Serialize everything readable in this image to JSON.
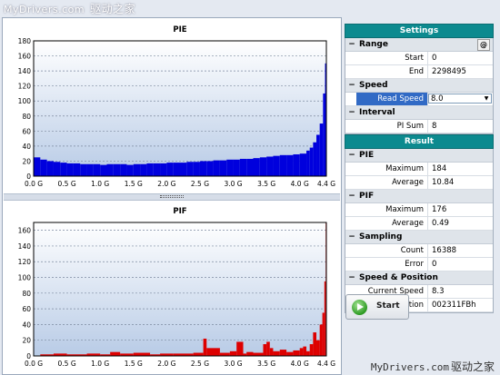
{
  "watermark_top": {
    "text": "MyDrivers.com",
    "zh": "驱动之家"
  },
  "watermark_bottom": {
    "text": "MyDrivers.com",
    "zh": "驱动之家"
  },
  "chart_data": [
    {
      "type": "bar",
      "title": "PIE",
      "color": "#0000dd",
      "xlim": [
        0,
        4.4
      ],
      "ylim": [
        0,
        180
      ],
      "xticks": [
        "0.0 G",
        "0.5 G",
        "1.0 G",
        "1.5 G",
        "2.0 G",
        "2.5 G",
        "3.0 G",
        "3.5 G",
        "4.0 G",
        "4.4 G"
      ],
      "xtick_values": [
        0,
        0.5,
        1.0,
        1.5,
        2.0,
        2.5,
        3.0,
        3.5,
        4.0,
        4.4
      ],
      "yticks": [
        0,
        20,
        40,
        60,
        80,
        100,
        120,
        140,
        160,
        180
      ],
      "x": [
        0.0,
        0.1,
        0.2,
        0.3,
        0.4,
        0.5,
        0.6,
        0.7,
        0.8,
        0.9,
        1.0,
        1.1,
        1.2,
        1.3,
        1.4,
        1.5,
        1.6,
        1.7,
        1.8,
        1.9,
        2.0,
        2.1,
        2.2,
        2.3,
        2.4,
        2.5,
        2.6,
        2.7,
        2.8,
        2.9,
        3.0,
        3.1,
        3.2,
        3.3,
        3.4,
        3.5,
        3.6,
        3.7,
        3.8,
        3.9,
        4.0,
        4.1,
        4.15,
        4.2,
        4.25,
        4.3,
        4.35,
        4.38
      ],
      "values": [
        25,
        22,
        20,
        19,
        18,
        17,
        17,
        16,
        16,
        16,
        15,
        16,
        16,
        16,
        15,
        16,
        16,
        17,
        17,
        17,
        18,
        18,
        18,
        19,
        19,
        20,
        20,
        21,
        21,
        22,
        22,
        23,
        23,
        24,
        25,
        26,
        27,
        28,
        28,
        29,
        30,
        34,
        38,
        45,
        55,
        70,
        110,
        150
      ]
    },
    {
      "type": "bar",
      "title": "PIF",
      "color": "#dd0000",
      "xlim": [
        0,
        4.4
      ],
      "ylim": [
        0,
        170
      ],
      "xticks": [
        "0.0 G",
        "0.5 G",
        "1.0 G",
        "1.5 G",
        "2.0 G",
        "2.5 G",
        "3.0 G",
        "3.5 G",
        "4.0 G",
        "4.4 G"
      ],
      "xtick_values": [
        0,
        0.5,
        1.0,
        1.5,
        2.0,
        2.5,
        3.0,
        3.5,
        4.0,
        4.4
      ],
      "yticks": [
        0,
        20,
        40,
        60,
        80,
        100,
        120,
        140,
        160
      ],
      "x": [
        0.1,
        0.3,
        0.5,
        0.8,
        1.0,
        1.15,
        1.3,
        1.5,
        1.75,
        1.9,
        2.1,
        2.2,
        2.4,
        2.55,
        2.6,
        2.8,
        2.95,
        3.05,
        3.15,
        3.2,
        3.3,
        3.45,
        3.5,
        3.55,
        3.6,
        3.7,
        3.8,
        3.9,
        4.0,
        4.05,
        4.1,
        4.15,
        4.2,
        4.25,
        4.3,
        4.34,
        4.37,
        4.39
      ],
      "values": [
        2,
        3,
        2,
        3,
        2,
        5,
        3,
        4,
        2,
        3,
        3,
        3,
        4,
        22,
        10,
        4,
        6,
        18,
        3,
        5,
        4,
        15,
        18,
        10,
        6,
        8,
        5,
        7,
        10,
        12,
        6,
        15,
        30,
        20,
        40,
        55,
        95,
        170
      ]
    }
  ],
  "settings": {
    "title": "Settings",
    "range": {
      "label": "Range",
      "at_label": "@",
      "start_label": "Start",
      "start_value": "0",
      "end_label": "End",
      "end_value": "2298495"
    },
    "speed": {
      "label": "Speed",
      "read_speed_label": "Read Speed",
      "read_speed_value": "8.0"
    },
    "interval": {
      "label": "Interval",
      "pi_sum_label": "PI Sum",
      "pi_sum_value": "8"
    }
  },
  "result": {
    "title": "Result",
    "pie": {
      "label": "PIE",
      "max_label": "Maximum",
      "max_value": "184",
      "avg_label": "Average",
      "avg_value": "10.84"
    },
    "pif": {
      "label": "PIF",
      "max_label": "Maximum",
      "max_value": "176",
      "avg_label": "Average",
      "avg_value": "0.49"
    },
    "sampling": {
      "label": "Sampling",
      "count_label": "Count",
      "count_value": "16388",
      "error_label": "Error",
      "error_value": "0"
    },
    "speed_position": {
      "label": "Speed & Position",
      "current_speed_label": "Current Speed",
      "current_speed_value": "8.3",
      "current_position_label": "Current Position",
      "current_position_value": "002311FBh"
    }
  },
  "start_button": {
    "label": "Start",
    "icon": "play-icon"
  }
}
